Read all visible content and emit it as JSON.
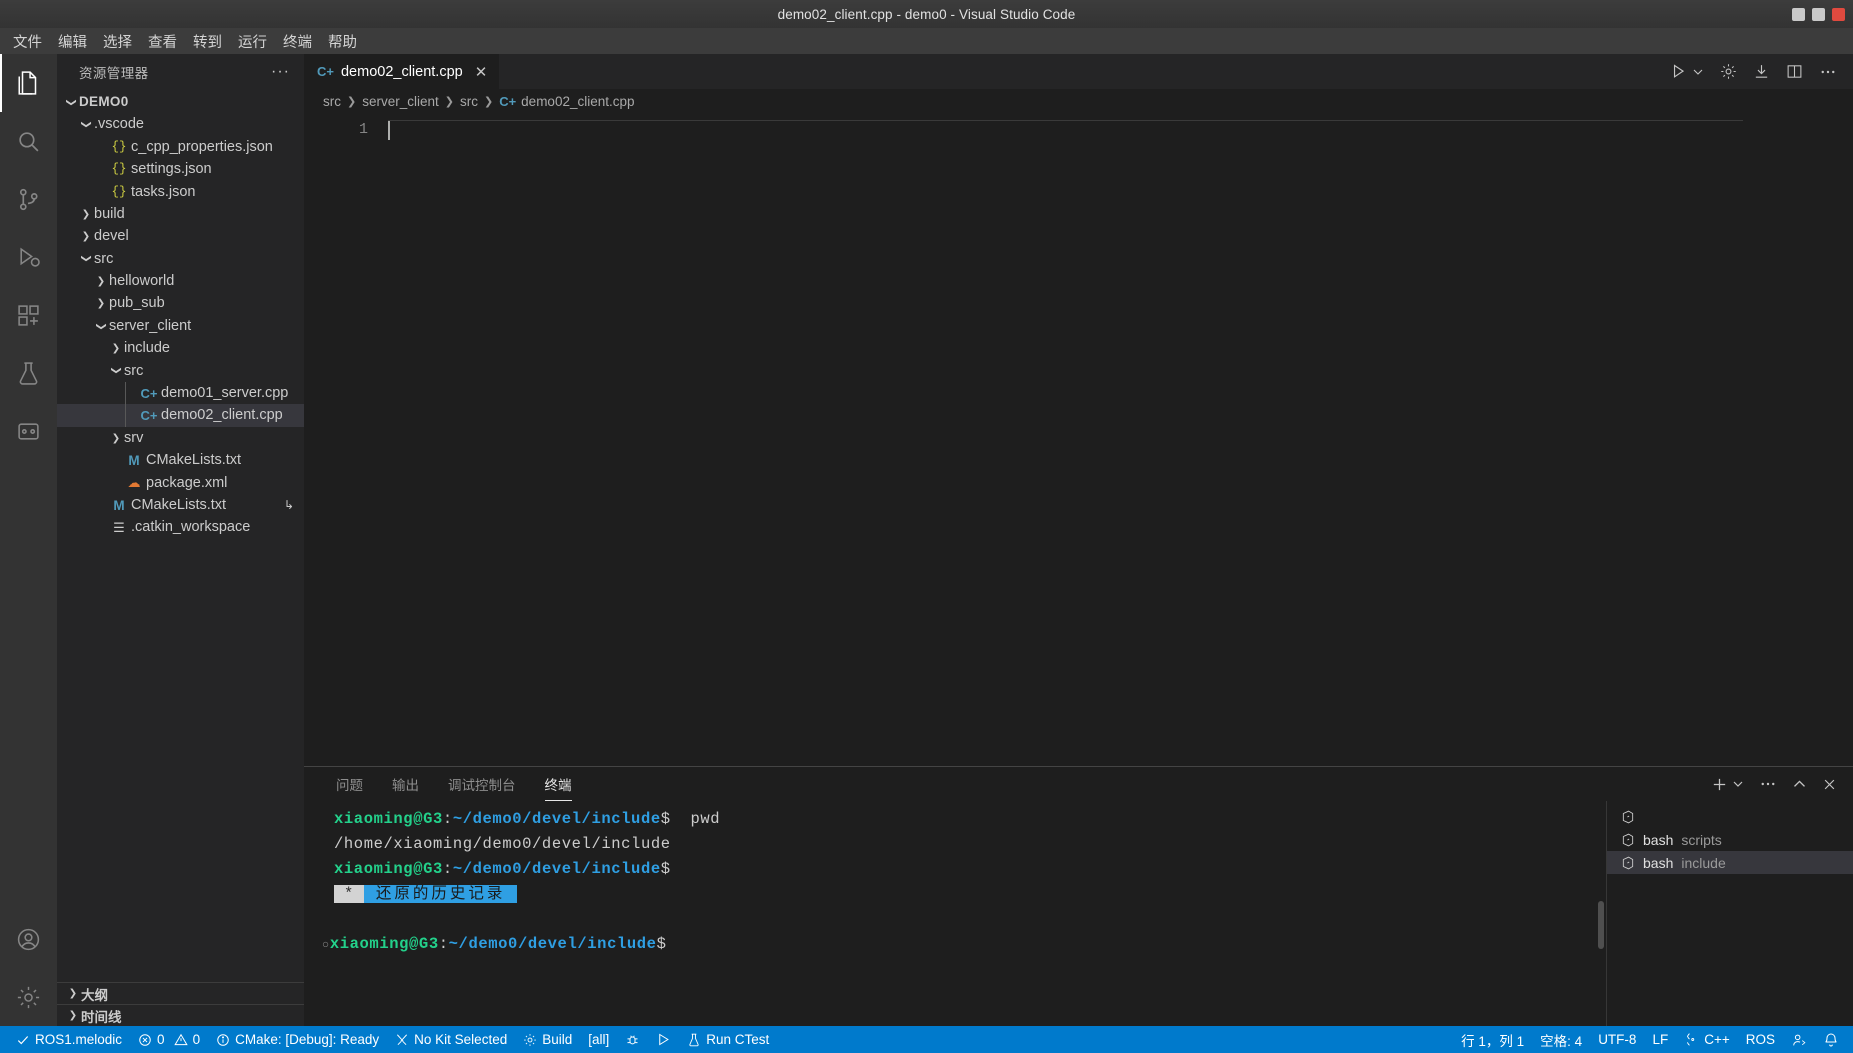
{
  "window": {
    "title": "demo02_client.cpp - demo0 - Visual Studio Code",
    "minimize_label": "—",
    "maximize_label": "□",
    "close_label": "✕"
  },
  "menubar": {
    "items": [
      {
        "label": "文件"
      },
      {
        "label": "编辑"
      },
      {
        "label": "选择"
      },
      {
        "label": "查看"
      },
      {
        "label": "转到"
      },
      {
        "label": "运行"
      },
      {
        "label": "终端"
      },
      {
        "label": "帮助"
      }
    ]
  },
  "activitybar": {
    "items": [
      {
        "name": "explorer",
        "icon": "files-icon",
        "active": true
      },
      {
        "name": "search",
        "icon": "search-icon",
        "active": false
      },
      {
        "name": "source-control",
        "icon": "source-control-icon",
        "active": false
      },
      {
        "name": "run-debug",
        "icon": "run-debug-icon",
        "active": false
      },
      {
        "name": "extensions",
        "icon": "extensions-icon",
        "active": false
      },
      {
        "name": "testing",
        "icon": "beaker-icon",
        "active": false
      },
      {
        "name": "ros",
        "icon": "ros-icon",
        "active": false
      }
    ],
    "bottom": [
      {
        "name": "accounts",
        "icon": "account-icon"
      },
      {
        "name": "manage",
        "icon": "gear-icon"
      }
    ]
  },
  "sidebar": {
    "header": "资源管理器",
    "more_label": "···",
    "tree": [
      {
        "label": "DEMO0",
        "depth": 0,
        "twisty": "down",
        "icon": "none",
        "root": true,
        "selected": false
      },
      {
        "label": ".vscode",
        "depth": 1,
        "twisty": "down",
        "icon": "none",
        "selected": false
      },
      {
        "label": "c_cpp_properties.json",
        "depth": 2,
        "twisty": "none",
        "icon": "json",
        "selected": false
      },
      {
        "label": "settings.json",
        "depth": 2,
        "twisty": "none",
        "icon": "json",
        "selected": false
      },
      {
        "label": "tasks.json",
        "depth": 2,
        "twisty": "none",
        "icon": "json",
        "selected": false
      },
      {
        "label": "build",
        "depth": 1,
        "twisty": "right",
        "icon": "none",
        "selected": false
      },
      {
        "label": "devel",
        "depth": 1,
        "twisty": "right",
        "icon": "none",
        "selected": false
      },
      {
        "label": "src",
        "depth": 1,
        "twisty": "down",
        "icon": "none",
        "selected": false
      },
      {
        "label": "helloworld",
        "depth": 2,
        "twisty": "right",
        "icon": "none",
        "selected": false
      },
      {
        "label": "pub_sub",
        "depth": 2,
        "twisty": "right",
        "icon": "none",
        "selected": false
      },
      {
        "label": "server_client",
        "depth": 2,
        "twisty": "down",
        "icon": "none",
        "selected": false
      },
      {
        "label": "include",
        "depth": 3,
        "twisty": "right",
        "icon": "none",
        "selected": false
      },
      {
        "label": "src",
        "depth": 3,
        "twisty": "down",
        "icon": "none",
        "selected": false
      },
      {
        "label": "demo01_server.cpp",
        "depth": 4,
        "twisty": "none",
        "icon": "cpp",
        "selected": false
      },
      {
        "label": "demo02_client.cpp",
        "depth": 4,
        "twisty": "none",
        "icon": "cpp",
        "selected": true
      },
      {
        "label": "srv",
        "depth": 3,
        "twisty": "right",
        "icon": "none",
        "selected": false
      },
      {
        "label": "CMakeLists.txt",
        "depth": 3,
        "twisty": "none",
        "icon": "m",
        "selected": false
      },
      {
        "label": "package.xml",
        "depth": 3,
        "twisty": "none",
        "icon": "xml",
        "selected": false
      },
      {
        "label": "CMakeLists.txt",
        "depth": 2,
        "twisty": "none",
        "icon": "m",
        "selected": false,
        "extra": "↳"
      },
      {
        "label": ".catkin_workspace",
        "depth": 2,
        "twisty": "none",
        "icon": "txtfile",
        "selected": false
      }
    ],
    "sections": [
      {
        "label": "大纲"
      },
      {
        "label": "时间线"
      }
    ]
  },
  "editor": {
    "tab": {
      "label": "demo02_client.cpp",
      "icon": "cpp-file-icon",
      "close": "✕"
    },
    "tab_actions": [
      {
        "name": "run-or-debug",
        "icon": "run-play-icon"
      },
      {
        "name": "run-dropdown",
        "icon": "chevron-down-icon"
      },
      {
        "name": "settings",
        "icon": "gear-icon"
      },
      {
        "name": "download",
        "icon": "download-icon"
      },
      {
        "name": "split-editor",
        "icon": "split-editor-icon"
      },
      {
        "name": "more-actions",
        "icon": "ellipsis-icon"
      }
    ],
    "breadcrumbs": [
      "src",
      "server_client",
      "src",
      "demo02_client.cpp"
    ],
    "line_numbers": [
      "1"
    ],
    "content": ""
  },
  "panel": {
    "tabs": [
      {
        "label": "问题",
        "active": false
      },
      {
        "label": "输出",
        "active": false
      },
      {
        "label": "调试控制台",
        "active": false
      },
      {
        "label": "终端",
        "active": true
      }
    ],
    "actions": [
      {
        "name": "new-terminal",
        "icon": "plus-icon"
      },
      {
        "name": "terminal-dropdown",
        "icon": "chevron-down-icon"
      },
      {
        "name": "panel-more",
        "icon": "ellipsis-icon"
      },
      {
        "name": "maximize-panel",
        "icon": "chevron-up-icon"
      },
      {
        "name": "close-panel",
        "icon": "close-icon"
      }
    ],
    "terminal": {
      "lines": [
        {
          "type": "prompt",
          "user": "xiaoming@G3",
          "sep": ":",
          "path": "~/demo0/devel/include",
          "dollar": "$",
          "command": "  pwd",
          "marker": ""
        },
        {
          "type": "output",
          "text": "/home/xiaoming/demo0/devel/include"
        },
        {
          "type": "prompt",
          "user": "xiaoming@G3",
          "sep": ":",
          "path": "~/demo0/devel/include",
          "dollar": "$",
          "command": "",
          "marker": ""
        },
        {
          "type": "history",
          "star": "*",
          "text": "还原的历史记录"
        },
        {
          "type": "blank",
          "text": ""
        },
        {
          "type": "prompt",
          "user": "xiaoming@G3",
          "sep": ":",
          "path": "~/demo0/devel/include",
          "dollar": "$",
          "command": "",
          "marker": "○"
        }
      ]
    },
    "terminal_list": [
      {
        "name": "",
        "sub": "",
        "icon": "terminal-icon",
        "selected": false
      },
      {
        "name": "bash",
        "sub": "scripts",
        "icon": "terminal-icon",
        "selected": false
      },
      {
        "name": "bash",
        "sub": "include",
        "icon": "terminal-icon",
        "selected": true
      }
    ]
  },
  "statusbar": {
    "left": [
      {
        "name": "ros-distro",
        "icon": "check-icon",
        "label": "ROS1.melodic"
      },
      {
        "name": "problems",
        "icon": "error-icon",
        "label": "0",
        "icon2": "warning-icon",
        "label2": "0"
      },
      {
        "name": "cmake-status",
        "icon": "info-icon",
        "label": "CMake: [Debug]: Ready"
      },
      {
        "name": "cmake-kit",
        "icon": "tools-icon",
        "label": "No Kit Selected"
      },
      {
        "name": "cmake-build",
        "icon": "gear-icon",
        "label": "Build"
      },
      {
        "name": "cmake-target",
        "icon": "none",
        "label": "[all]"
      },
      {
        "name": "cmake-debug",
        "icon": "bug-icon",
        "label": ""
      },
      {
        "name": "cmake-launch",
        "icon": "play-icon",
        "label": ""
      },
      {
        "name": "run-ctest",
        "icon": "beaker-icon",
        "label": "Run CTest"
      }
    ],
    "right": [
      {
        "name": "cursor-position",
        "label": "行 1，列 1"
      },
      {
        "name": "indentation",
        "label": "空格: 4"
      },
      {
        "name": "encoding",
        "label": "UTF-8"
      },
      {
        "name": "eol",
        "label": "LF"
      },
      {
        "name": "language-mode",
        "icon": "braces-icon",
        "label": "C++"
      },
      {
        "name": "ros-status",
        "label": "ROS"
      },
      {
        "name": "live-share",
        "icon": "live-share-icon",
        "label": ""
      },
      {
        "name": "notifications",
        "icon": "bell-icon",
        "label": ""
      }
    ]
  },
  "colors": {
    "accent": "#007acc",
    "selection": "#37373d",
    "terminal_green": "#23d18b",
    "terminal_blue": "#2f9fe3",
    "highlight_blue": "#2f9fe3"
  }
}
